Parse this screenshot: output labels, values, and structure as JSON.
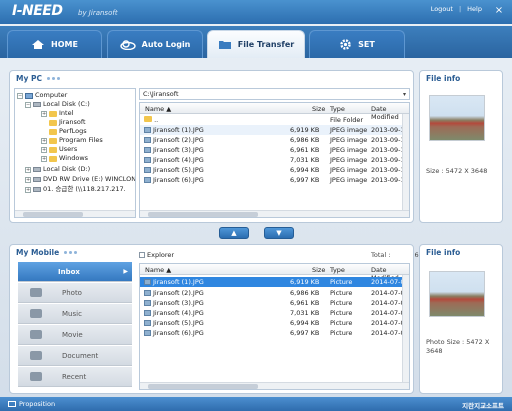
{
  "app": {
    "logo": "I-NEED",
    "logo_sub": "by Jiransoft",
    "logout": "Logout",
    "help": "Help",
    "close_glyph": "×"
  },
  "tabs": [
    {
      "label": "HOME",
      "icon": "house-icon"
    },
    {
      "label": "Auto Login",
      "icon": "cloud-icon"
    },
    {
      "label": "File Transfer",
      "icon": "folder-icon",
      "active": true
    },
    {
      "label": "SET",
      "icon": "gear-icon"
    }
  ],
  "mypc": {
    "title": "My PC",
    "tree": [
      {
        "label": "Computer",
        "depth": 0,
        "icon": "pc-icon",
        "exp": "−"
      },
      {
        "label": "Local Disk (C:)",
        "depth": 1,
        "icon": "drive-icon",
        "exp": "−"
      },
      {
        "label": "Intel",
        "depth": 2,
        "icon": "folder-icon",
        "exp": "+"
      },
      {
        "label": "Jiransoft",
        "depth": 2,
        "icon": "folder-icon",
        "exp": ""
      },
      {
        "label": "PerfLogs",
        "depth": 2,
        "icon": "folder-icon",
        "exp": ""
      },
      {
        "label": "Program Files",
        "depth": 2,
        "icon": "folder-icon",
        "exp": "+"
      },
      {
        "label": "Users",
        "depth": 2,
        "icon": "folder-icon",
        "exp": "+"
      },
      {
        "label": "Windows",
        "depth": 2,
        "icon": "folder-icon",
        "exp": "+"
      },
      {
        "label": "Local Disk (D:)",
        "depth": 1,
        "icon": "drive-icon",
        "exp": "+"
      },
      {
        "label": "DVD RW Drive (E:) WINCLON",
        "depth": 1,
        "icon": "drive-icon",
        "exp": "+"
      },
      {
        "label": "01. 승급한 (\\\\118.217.217.",
        "depth": 1,
        "icon": "drive-icon",
        "exp": "+"
      }
    ],
    "path": "C:\\Jiransoft",
    "path_dropdown": "▾",
    "columns": [
      "Name ▲",
      "Size",
      "Type",
      "Date Modified"
    ],
    "files": [
      {
        "name": "..",
        "size": "",
        "type": "File Folder",
        "date": ""
      },
      {
        "name": "Jiransoft (1).JPG",
        "size": "6,919 KB",
        "type": "JPEG image",
        "date": "2013-09-10 2"
      },
      {
        "name": "Jiransoft (2).JPG",
        "size": "6,986 KB",
        "type": "JPEG image",
        "date": "2013-09-10 2"
      },
      {
        "name": "Jiransoft (3).JPG",
        "size": "6,961 KB",
        "type": "JPEG image",
        "date": "2013-09-10 2"
      },
      {
        "name": "Jiransoft (4).JPG",
        "size": "7,031 KB",
        "type": "JPEG image",
        "date": "2013-09-10 2"
      },
      {
        "name": "Jiransoft (5).JPG",
        "size": "6,994 KB",
        "type": "JPEG image",
        "date": "2013-09-10 2"
      },
      {
        "name": "Jiransoft (6).JPG",
        "size": "6,997 KB",
        "type": "JPEG image",
        "date": "2013-09-10 2"
      }
    ]
  },
  "transfer": {
    "up": "▲",
    "down": "▼"
  },
  "fileinfo_top": {
    "title": "File info",
    "size_text": "Size : 5472 X 3648"
  },
  "mymobile": {
    "title": "My Mobile",
    "sidebar": [
      {
        "label": "Inbox",
        "icon": "inbox-icon",
        "active": true
      },
      {
        "label": "Photo",
        "icon": "camera-icon"
      },
      {
        "label": "Music",
        "icon": "music-icon"
      },
      {
        "label": "Movie",
        "icon": "film-icon"
      },
      {
        "label": "Document",
        "icon": "document-icon"
      },
      {
        "label": "Recent",
        "icon": "clock-icon"
      }
    ],
    "explorer_label": "Explorer",
    "total_label": "Total :",
    "total_value": "6",
    "columns": [
      "Name ▲",
      "Size",
      "Type",
      "Date Modified"
    ],
    "files": [
      {
        "name": "Jiransoft (1).JPG",
        "size": "6,919 KB",
        "type": "Picture",
        "date": "2014-07-03 0",
        "selected": true
      },
      {
        "name": "Jiransoft (2).JPG",
        "size": "6,986 KB",
        "type": "Picture",
        "date": "2014-07-03 0"
      },
      {
        "name": "Jiransoft (3).JPG",
        "size": "6,961 KB",
        "type": "Picture",
        "date": "2014-07-03 0"
      },
      {
        "name": "Jiransoft (4).JPG",
        "size": "7,031 KB",
        "type": "Picture",
        "date": "2014-07-03 0"
      },
      {
        "name": "Jiransoft (5).JPG",
        "size": "6,994 KB",
        "type": "Picture",
        "date": "2014-07-03 0"
      },
      {
        "name": "Jiransoft (6).JPG",
        "size": "6,997 KB",
        "type": "Picture",
        "date": "2014-07-03 0"
      }
    ]
  },
  "fileinfo_bottom": {
    "title": "File info",
    "size_text": "Photo Size : 5472 X 3648"
  },
  "footer": {
    "left": "Proposition",
    "right": "지란지교소프트"
  }
}
